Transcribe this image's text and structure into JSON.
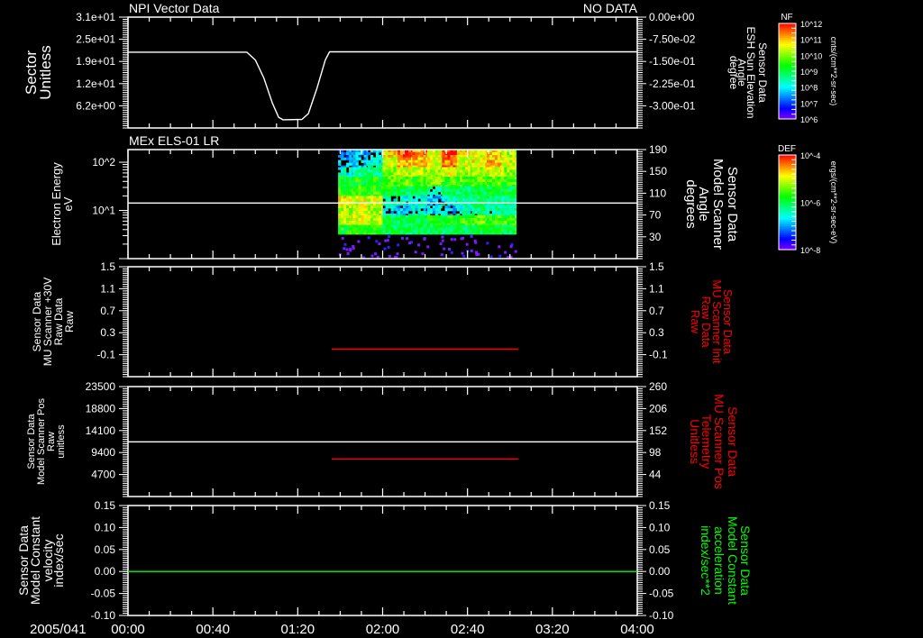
{
  "header": {
    "title_left": "NPI Vector Data",
    "title_right": "NO DATA",
    "panel2_title": "MEx ELS-01 LR"
  },
  "time_axis": {
    "date": "2005/041",
    "ticks": [
      "00:00",
      "00:40",
      "01:20",
      "02:00",
      "02:40",
      "03:20",
      "04:00"
    ]
  },
  "colorbars": [
    {
      "title": "NF",
      "units": "cnts/(cm**2-sr-sec)",
      "labels": [
        "10^12",
        "10^11",
        "10^10",
        "10^9",
        "10^8",
        "10^7",
        "10^6"
      ]
    },
    {
      "title": "DEF",
      "units": "ergs/(cm**2-sr-sec-eV)",
      "labels": [
        "10^-4",
        "10^-6",
        "10^-8"
      ]
    }
  ],
  "chart_data": [
    {
      "type": "line",
      "left_label": [
        "Sector",
        "Unitless"
      ],
      "right_label": [
        "Sensor Data",
        "ESH Sun Elevation",
        "Angle",
        "degree"
      ],
      "right_label_color": "#ffffff",
      "left_axis": {
        "ylim": [
          0,
          31
        ],
        "ticks": [
          {
            "label": "3.1e+01",
            "value": 31
          },
          {
            "label": "2.5e+01",
            "value": 24.8
          },
          {
            "label": "1.9e+01",
            "value": 18.6
          },
          {
            "label": "1.2e+01",
            "value": 12.4
          },
          {
            "label": "6.2e+00",
            "value": 6.2
          }
        ]
      },
      "right_axis": {
        "ylim": [
          -0.375,
          0
        ],
        "ticks": [
          {
            "label": "0.00e+00",
            "value": 0
          },
          {
            "label": "-7.50e-02",
            "value": -0.075
          },
          {
            "label": "-1.50e-01",
            "value": -0.15
          },
          {
            "label": "-2.25e-01",
            "value": -0.225
          },
          {
            "label": "-3.00e-01",
            "value": -0.3
          }
        ]
      },
      "series": [
        {
          "axis": "left",
          "color": "#ffffff",
          "points": [
            [
              "00:00",
              21.2
            ],
            [
              "00:56",
              21.2
            ],
            [
              "01:00",
              19
            ],
            [
              "01:04",
              14
            ],
            [
              "01:08",
              7
            ],
            [
              "01:11",
              3
            ],
            [
              "01:13",
              2.3
            ],
            [
              "01:22",
              2.4
            ],
            [
              "01:25",
              4
            ],
            [
              "01:29",
              11
            ],
            [
              "01:33",
              19
            ],
            [
              "01:35",
              21.3
            ],
            [
              "04:00",
              21.3
            ]
          ]
        }
      ]
    },
    {
      "type": "heatmap",
      "left_label": [
        "Electron Energy",
        "eV"
      ],
      "right_label": [
        "Sensor Data",
        "Model Scanner",
        "Angle",
        "degrees"
      ],
      "right_label_color": "#ffffff",
      "left_axis": {
        "scale": "log",
        "ylim": [
          1,
          183
        ],
        "ticks": [
          {
            "label": "10^2",
            "value": 100
          },
          {
            "label": "10^1",
            "value": 10
          }
        ]
      },
      "right_axis": {
        "ylim": [
          -10,
          190
        ],
        "ticks": [
          {
            "label": "190",
            "value": 190
          },
          {
            "label": "150",
            "value": 150
          },
          {
            "label": "110",
            "value": 110
          },
          {
            "label": "70",
            "value": 70
          },
          {
            "label": "30",
            "value": 30
          }
        ]
      },
      "colorbar": "DEF",
      "zlim_log10": [
        -8,
        -4
      ],
      "time_bins": [
        "01:39",
        "01:46",
        "01:53",
        "02:00",
        "02:07",
        "02:14",
        "02:21",
        "02:28",
        "02:35",
        "02:42",
        "02:49",
        "02:56"
      ],
      "time_end": "03:03",
      "energies_eV": [
        160,
        100,
        63,
        40,
        25,
        16,
        10,
        6.3,
        4
      ],
      "log10_def": [
        [
          -7.2,
          -7.0,
          -6.8,
          -4.8,
          -4.3,
          -4.4,
          -5.0,
          -4.2,
          -4.9,
          -5.0,
          -4.8,
          -5.2
        ],
        [
          -7.0,
          -6.8,
          -6.6,
          -5.0,
          -4.6,
          -4.7,
          -5.0,
          -4.4,
          -5.0,
          -4.9,
          -4.7,
          -5.1
        ],
        [
          -6.5,
          -6.3,
          -6.2,
          -5.3,
          -5.1,
          -5.2,
          -5.2,
          -5.0,
          -5.3,
          -5.2,
          -5.0,
          -5.3
        ],
        [
          -5.9,
          -5.8,
          -5.8,
          -5.5,
          -5.5,
          -5.6,
          -5.4,
          -5.6,
          -5.6,
          -5.5,
          -5.5,
          -5.6
        ],
        [
          -5.8,
          -5.7,
          -5.7,
          -5.9,
          -6.0,
          -6.0,
          -6.5,
          -6.0,
          -6.1,
          -6.0,
          -5.9,
          -6.0
        ],
        [
          -4.9,
          -5.0,
          -5.1,
          -6.5,
          -6.6,
          -6.5,
          -7.0,
          -6.6,
          -6.4,
          -6.2,
          -6.2,
          -6.2
        ],
        [
          -5.2,
          -5.1,
          -5.2,
          -6.7,
          -6.8,
          -6.7,
          -6.8,
          -6.9,
          -6.5,
          -6.3,
          -6.3,
          -6.4
        ],
        [
          -5.1,
          -5.0,
          -5.1,
          -6.0,
          -6.1,
          -5.9,
          -5.8,
          -5.8,
          -5.6,
          -5.5,
          -5.6,
          -5.6
        ],
        [
          -5.8,
          -5.7,
          -5.8,
          -6.0,
          -6.1,
          -6.0,
          -6.0,
          -6.1,
          -6.0,
          -6.0,
          -5.9,
          -6.0
        ]
      ],
      "series": [
        {
          "axis": "right",
          "color": "#ffffff",
          "points": [
            [
              "00:00",
              92
            ],
            [
              "04:00",
              92
            ]
          ]
        }
      ]
    },
    {
      "type": "line",
      "left_label": [
        "Sensor Data",
        "MU Scanner +30V",
        "Raw Data",
        "Raw"
      ],
      "right_label": [
        "Sensor Data",
        "MU Scanner Init",
        "Raw Data",
        "Raw"
      ],
      "right_label_color": "#ff0000",
      "left_axis": {
        "ylim": [
          -0.5,
          1.5
        ],
        "ticks": [
          {
            "label": "1.5",
            "value": 1.5
          },
          {
            "label": "1.1",
            "value": 1.1
          },
          {
            "label": "0.7",
            "value": 0.7
          },
          {
            "label": "0.3",
            "value": 0.3
          },
          {
            "label": "-0.1",
            "value": -0.1
          }
        ]
      },
      "right_axis": {
        "ylim": [
          -0.5,
          1.5
        ],
        "ticks": [
          {
            "label": "1.5",
            "value": 1.5
          },
          {
            "label": "1.1",
            "value": 1.1
          },
          {
            "label": "0.7",
            "value": 0.7
          },
          {
            "label": "0.3",
            "value": 0.3
          },
          {
            "label": "-0.1",
            "value": -0.1
          }
        ]
      },
      "series": [
        {
          "axis": "right",
          "color": "#ff0000",
          "points": [
            [
              "01:36",
              0.0
            ],
            [
              "03:04",
              0.0
            ]
          ]
        }
      ]
    },
    {
      "type": "line",
      "left_label": [
        "Sensor Data",
        "Model Scanner Pos",
        "Raw",
        "unitless"
      ],
      "right_label": [
        "Sensor Data",
        "MU Scanner Pos",
        "Telemetry",
        "Unitless"
      ],
      "right_label_color": "#ff0000",
      "left_axis": {
        "ylim": [
          0,
          23500
        ],
        "ticks": [
          {
            "label": "23500",
            "value": 23500
          },
          {
            "label": "18800",
            "value": 18800
          },
          {
            "label": "14100",
            "value": 14100
          },
          {
            "label": "9400",
            "value": 9400
          },
          {
            "label": "4700",
            "value": 4700
          }
        ]
      },
      "right_axis": {
        "ylim": [
          -10,
          260
        ],
        "ticks": [
          {
            "label": "260",
            "value": 260
          },
          {
            "label": "206",
            "value": 206
          },
          {
            "label": "152",
            "value": 152
          },
          {
            "label": "98",
            "value": 98
          },
          {
            "label": "44",
            "value": 44
          }
        ]
      },
      "series": [
        {
          "axis": "left",
          "color": "#ffffff",
          "points": [
            [
              "00:00",
              11700
            ],
            [
              "04:00",
              11700
            ]
          ]
        },
        {
          "axis": "right",
          "color": "#ff0000",
          "points": [
            [
              "01:36",
              82
            ],
            [
              "03:04",
              82
            ]
          ]
        }
      ]
    },
    {
      "type": "line",
      "left_label": [
        "Sensor Data",
        "Model Constant",
        "velocity",
        "index/sec"
      ],
      "right_label": [
        "Sensor Data",
        "Model Constant",
        "acceleration",
        "index/sec**2"
      ],
      "right_label_color": "#00ff00",
      "left_axis": {
        "ylim": [
          -0.1,
          0.15
        ],
        "ticks": [
          {
            "label": "0.15",
            "value": 0.15
          },
          {
            "label": "0.10",
            "value": 0.1
          },
          {
            "label": "0.05",
            "value": 0.05
          },
          {
            "label": "0.00",
            "value": 0
          },
          {
            "label": "-0.05",
            "value": -0.05
          },
          {
            "label": "-0.10",
            "value": -0.1
          }
        ]
      },
      "right_axis": {
        "ylim": [
          -0.1,
          0.15
        ],
        "ticks": [
          {
            "label": "0.15",
            "value": 0.15
          },
          {
            "label": "0.10",
            "value": 0.1
          },
          {
            "label": "0.05",
            "value": 0.05
          },
          {
            "label": "0.00",
            "value": 0
          },
          {
            "label": "-0.05",
            "value": -0.05
          },
          {
            "label": "-0.10",
            "value": -0.1
          }
        ]
      },
      "series": [
        {
          "axis": "left",
          "color": "#00ff00",
          "points": [
            [
              "00:00",
              0
            ],
            [
              "04:00",
              0
            ]
          ]
        }
      ]
    }
  ]
}
